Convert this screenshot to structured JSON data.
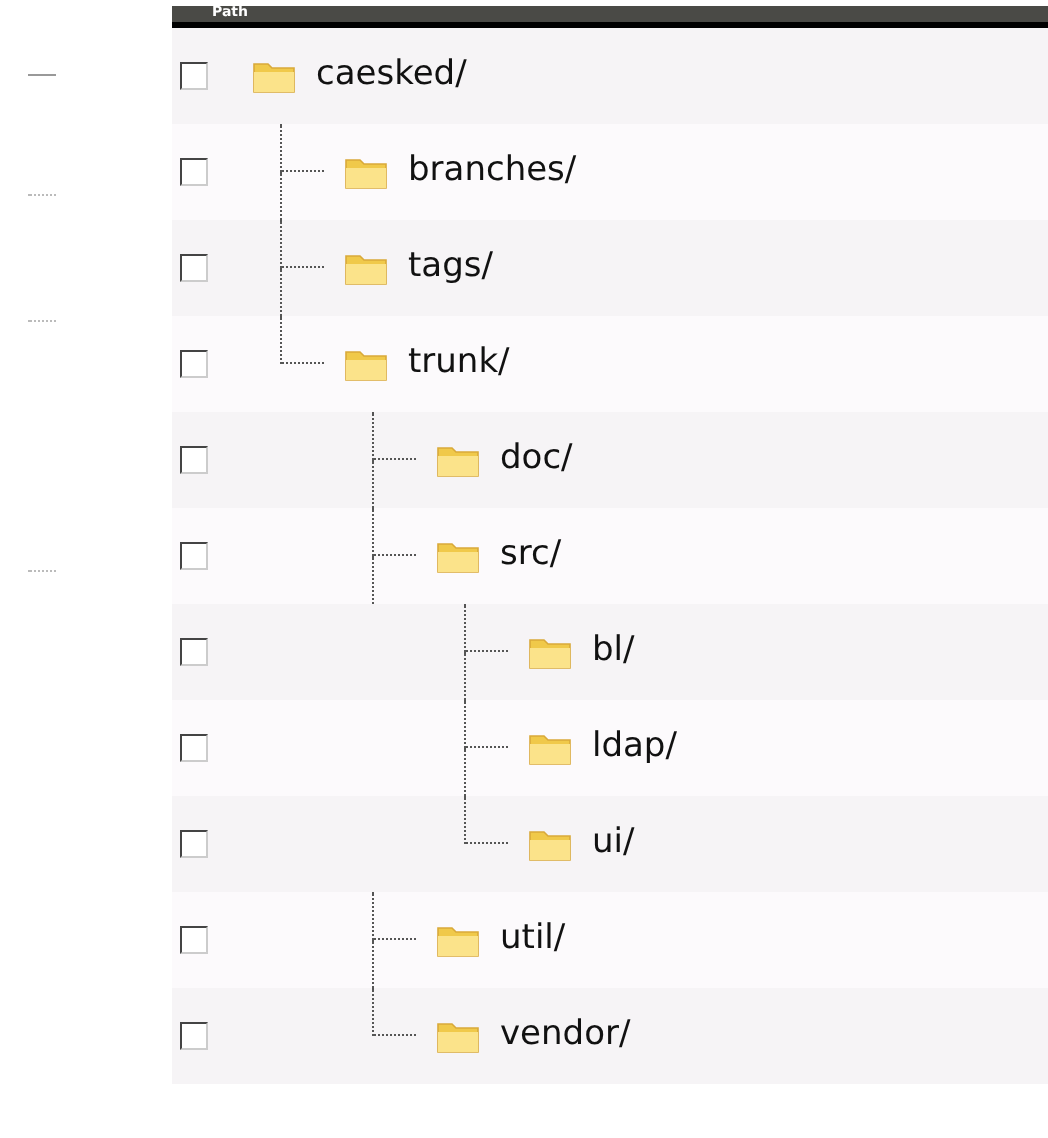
{
  "table": {
    "header": "Path",
    "tree": [
      {
        "name": "caesked/",
        "checked": false,
        "children": [
          {
            "name": "branches/",
            "checked": false
          },
          {
            "name": "tags/",
            "checked": false
          },
          {
            "name": "trunk/",
            "checked": false,
            "children": [
              {
                "name": "doc/",
                "checked": false
              },
              {
                "name": "src/",
                "checked": false,
                "children": [
                  {
                    "name": "bl/",
                    "checked": false
                  },
                  {
                    "name": "ldap/",
                    "checked": false
                  },
                  {
                    "name": "ui/",
                    "checked": false
                  }
                ]
              },
              {
                "name": "util/",
                "checked": false
              },
              {
                "name": "vendor/",
                "checked": false
              }
            ]
          }
        ]
      }
    ]
  }
}
